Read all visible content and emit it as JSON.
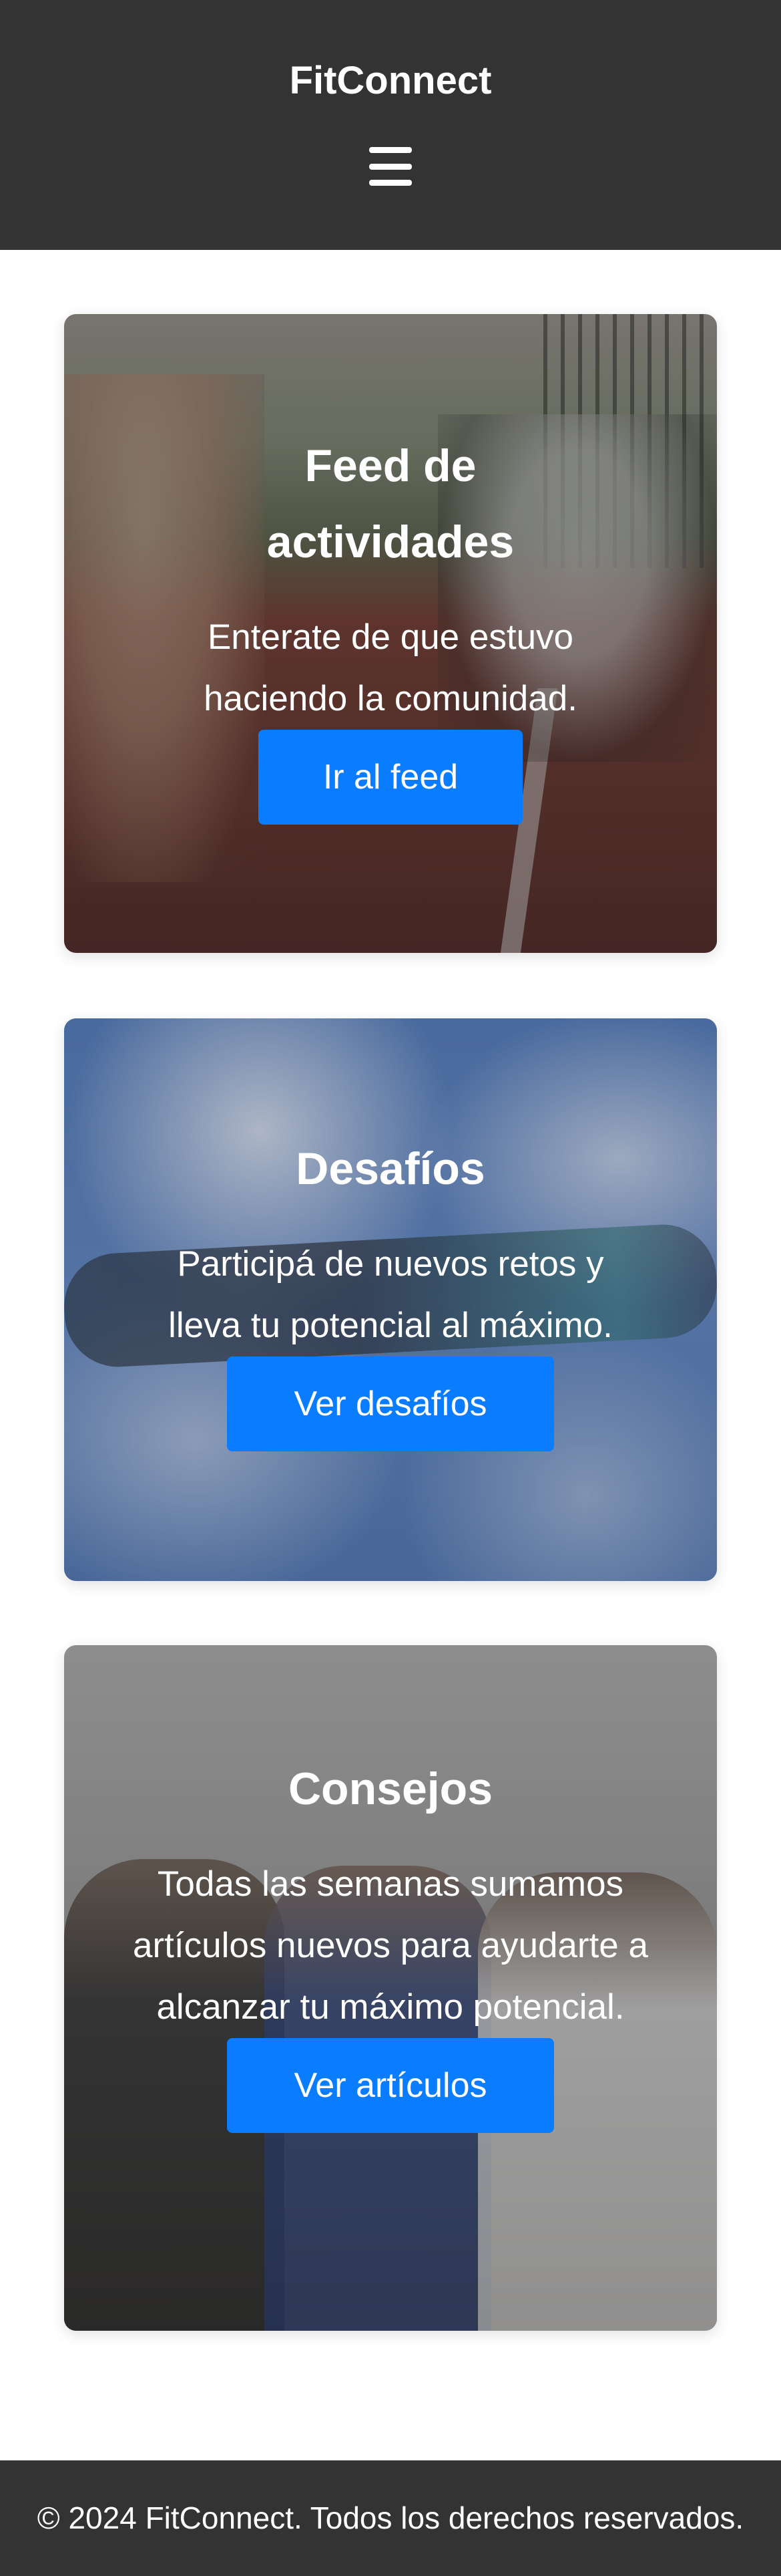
{
  "header": {
    "brand": "FitConnect",
    "menu_icon": "hamburger-menu-icon"
  },
  "cards": [
    {
      "title": "Feed de actividades",
      "description": "Enterate de que estuvo haciendo la comunidad.",
      "button_label": "Ir al feed"
    },
    {
      "title": "Desafíos",
      "description": "Participá de nuevos retos y lleva tu potencial al máximo.",
      "button_label": "Ver desafíos"
    },
    {
      "title": "Consejos",
      "description": "Todas las semanas sumamos artículos nuevos para ayudarte a alcanzar tu máximo potencial.",
      "button_label": "Ver artículos"
    }
  ],
  "footer": {
    "copyright": "© 2024 FitConnect. Todos los derechos reservados."
  },
  "colors": {
    "header_bg": "#333333",
    "button_bg": "#0a7cff",
    "text": "#ffffff"
  }
}
